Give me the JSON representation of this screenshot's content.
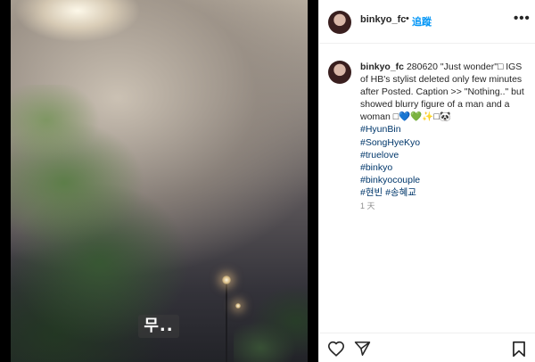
{
  "post": {
    "media_overlay_text": "무..",
    "author": {
      "username": "binkyo_fc",
      "separator": "•",
      "follow_label": "追蹤",
      "more_label": "•••"
    },
    "caption": {
      "username": "binkyo_fc",
      "text": "280620 \"Just wonder\"□ IGS of HB's stylist deleted only few minutes after Posted. Caption >> \"Nothing..\" but showed blurry figure of a man and a woman □💙💚✨□🐼",
      "hashtags": [
        "#HyunBin",
        "#SongHyeKyo",
        "#truelove",
        "#binkyo",
        "#binkyocouple",
        "#현빈 #송혜교"
      ],
      "time": "1 天"
    },
    "actions": {
      "like_icon": "heart-icon",
      "share_icon": "paper-plane-icon",
      "save_icon": "bookmark-icon"
    },
    "colors": {
      "link": "#00376b",
      "follow": "#0095f6",
      "text": "#262626",
      "muted": "#8e8e8e"
    }
  }
}
